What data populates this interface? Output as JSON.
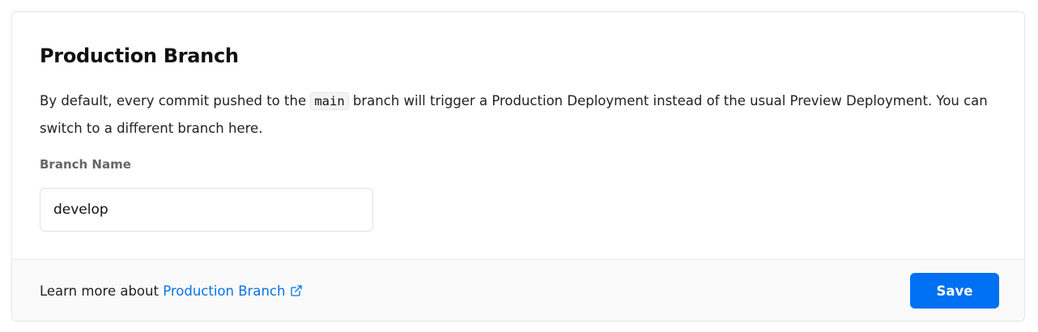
{
  "section": {
    "title": "Production Branch",
    "description_before": "By default, every commit pushed to the ",
    "description_code": "main",
    "description_after": " branch will trigger a Production Deployment instead of the usual Preview Deployment. You can switch to a different branch here."
  },
  "field": {
    "label": "Branch Name",
    "value": "develop"
  },
  "footer": {
    "learn_more_text": "Learn more about ",
    "link_text": "Production Branch",
    "link_icon": "external-link-icon",
    "save_label": "Save"
  },
  "colors": {
    "accent": "#0070f3",
    "link": "#0a72e6",
    "footer_bg": "#fafafa"
  }
}
